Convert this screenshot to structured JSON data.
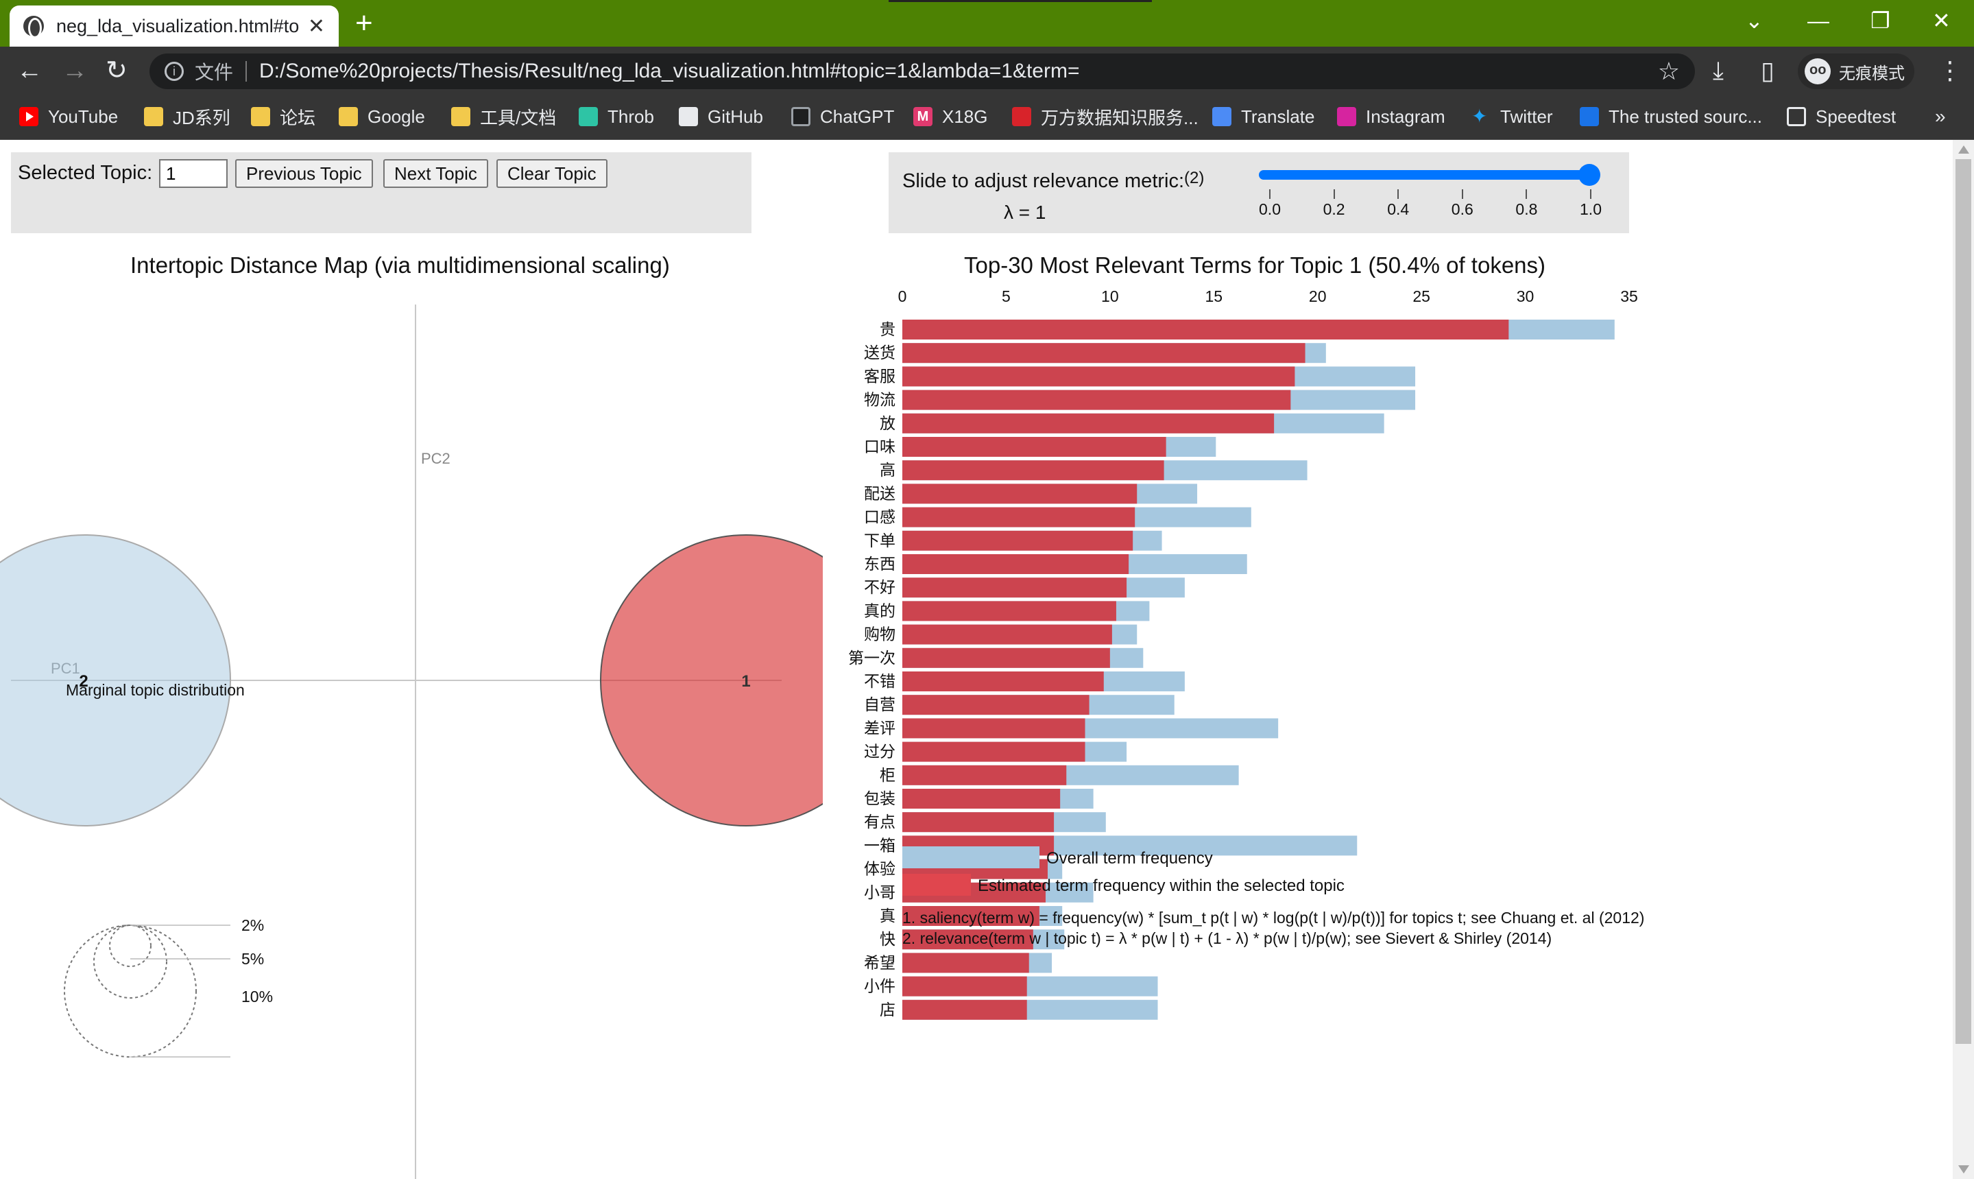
{
  "browser": {
    "tab_title": "neg_lda_visualization.html#top",
    "tab_close": "✕",
    "new_tab": "+",
    "address": {
      "scheme_label": "文件",
      "url": "D:/Some%20projects/Thesis/Result/neg_lda_visualization.html#topic=1&lambda=1&term="
    },
    "incognito_label": "无痕模式",
    "window_controls": {
      "dropdown": "⌄",
      "minimize": "—",
      "restore": "❐",
      "close": "✕"
    },
    "nav": {
      "back": "←",
      "forward": "→",
      "reload": "↻"
    },
    "toolbar_icons": {
      "star": "☆",
      "download": "⤓",
      "sidepanel": "▯",
      "menu": "⋮"
    },
    "bookmarks": [
      {
        "label": "YouTube",
        "icon": "youtube-icon"
      },
      {
        "label": "JD系列",
        "icon": "folder-icon"
      },
      {
        "label": "论坛",
        "icon": "folder-icon"
      },
      {
        "label": "Google",
        "icon": "folder-icon"
      },
      {
        "label": "工具/文档",
        "icon": "folder-icon"
      },
      {
        "label": "Throb",
        "icon": "throb-icon"
      },
      {
        "label": "GitHub",
        "icon": "github-icon"
      },
      {
        "label": "ChatGPT",
        "icon": "chatgpt-icon"
      },
      {
        "label": "X18G",
        "icon": "x18g-icon"
      },
      {
        "label": "万方数据知识服务...",
        "icon": "wanfang-icon"
      },
      {
        "label": "Translate",
        "icon": "translate-icon"
      },
      {
        "label": "Instagram",
        "icon": "instagram-icon"
      },
      {
        "label": "Twitter",
        "icon": "twitter-icon"
      },
      {
        "label": "The trusted sourc...",
        "icon": "trusted-source-icon"
      },
      {
        "label": "Speedtest",
        "icon": "speedtest-icon"
      }
    ],
    "bookmarks_more": "»"
  },
  "controls": {
    "selected_topic_label": "Selected Topic:",
    "selected_topic_value": "1",
    "previous_topic": "Previous Topic",
    "next_topic": "Next Topic",
    "clear_topic": "Clear Topic",
    "slider_label": "Slide to adjust relevance metric:",
    "slider_footnote": "(2)",
    "lambda_text": "λ = 1",
    "lambda_value": 1,
    "slider_ticks": [
      "0.0",
      "0.2",
      "0.4",
      "0.6",
      "0.8",
      "1.0"
    ]
  },
  "map": {
    "title": "Intertopic Distance Map (via multidimensional scaling)",
    "axis_pc1": "PC1",
    "axis_pc2": "PC2",
    "topics": [
      {
        "label": "1",
        "color": "#d62728",
        "selected": true
      },
      {
        "label": "2",
        "color": "#a6c8e0",
        "selected": false
      }
    ],
    "marginal_title": "Marginal topic distribution",
    "marginal_legend": [
      "2%",
      "5%",
      "10%"
    ]
  },
  "legend": {
    "overall": "Overall term frequency",
    "estimated": "Estimated term frequency within the selected topic",
    "overall_color": "#a6c8e0",
    "estimated_color": "#d62728"
  },
  "footnotes": [
    "1. saliency(term w) = frequency(w) * [sum_t p(t | w) * log(p(t | w)/p(t))] for topics t; see Chuang et. al (2012)",
    "2. relevance(term w | topic t) = λ * p(w | t) + (1 - λ) * p(w | t)/p(w); see Sievert & Shirley (2014)"
  ],
  "chart_data": [
    {
      "type": "bar",
      "orientation": "horizontal",
      "title": "Top-30 Most Relevant Terms for Topic 1 (50.4% of tokens)",
      "xlim": [
        0,
        35
      ],
      "x_ticks": [
        "0",
        "5",
        "10",
        "15",
        "20",
        "25",
        "30",
        "35"
      ],
      "categories": [
        "贵",
        "送货",
        "客服",
        "物流",
        "放",
        "口味",
        "高",
        "配送",
        "口感",
        "下单",
        "东西",
        "不好",
        "真的",
        "购物",
        "第一次",
        "不错",
        "自营",
        "差评",
        "过分",
        "柜",
        "包装",
        "有点",
        "一箱",
        "体验",
        "小哥",
        "真",
        "快",
        "希望",
        "小件",
        "店"
      ],
      "series": [
        {
          "name": "Overall term frequency",
          "color": "#a6c8e0",
          "values": [
            34.3,
            20.4,
            24.7,
            24.7,
            23.2,
            15.1,
            19.5,
            14.2,
            16.8,
            12.5,
            16.6,
            13.6,
            11.9,
            11.3,
            11.6,
            13.6,
            13.1,
            18.1,
            10.8,
            16.2,
            9.2,
            9.8,
            21.9,
            7.7,
            9.2,
            7.7,
            7.8,
            7.2,
            12.3,
            12.3
          ]
        },
        {
          "name": "Estimated term frequency within the selected topic",
          "color": "#d62728",
          "values": [
            29.2,
            19.4,
            18.9,
            18.7,
            17.9,
            12.7,
            12.6,
            11.3,
            11.2,
            11.1,
            10.9,
            10.8,
            10.3,
            10.1,
            10.0,
            9.7,
            9.0,
            8.8,
            8.8,
            7.9,
            7.6,
            7.3,
            7.3,
            7.0,
            6.9,
            6.6,
            6.3,
            6.1,
            6.0,
            6.0
          ]
        }
      ]
    },
    {
      "type": "scatter",
      "title": "Intertopic Distance Map (via multidimensional scaling)",
      "xlabel": "PC1",
      "ylabel": "PC2",
      "points": [
        {
          "label": "1",
          "x": 0.32,
          "y": 0.0,
          "size_share": 50.4
        },
        {
          "label": "2",
          "x": -0.32,
          "y": 0.0,
          "size_share": 49.6
        }
      ]
    }
  ]
}
